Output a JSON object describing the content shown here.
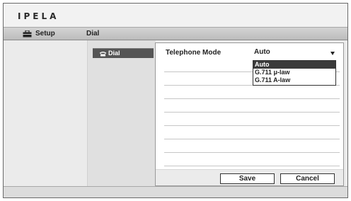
{
  "brand": {
    "logo": "IPELA"
  },
  "header": {
    "setup_label": "Setup",
    "breadcrumb": "Dial"
  },
  "nav": {
    "items": [
      {
        "label": "Dial",
        "icon": "phone-icon",
        "selected": true
      }
    ]
  },
  "form": {
    "telephone_mode": {
      "label": "Telephone Mode",
      "value": "Auto",
      "options": [
        "Auto",
        "G.711 μ-law",
        "G.711 A-law"
      ],
      "highlighted_option": "Auto"
    }
  },
  "buttons": {
    "save": "Save",
    "cancel": "Cancel"
  }
}
